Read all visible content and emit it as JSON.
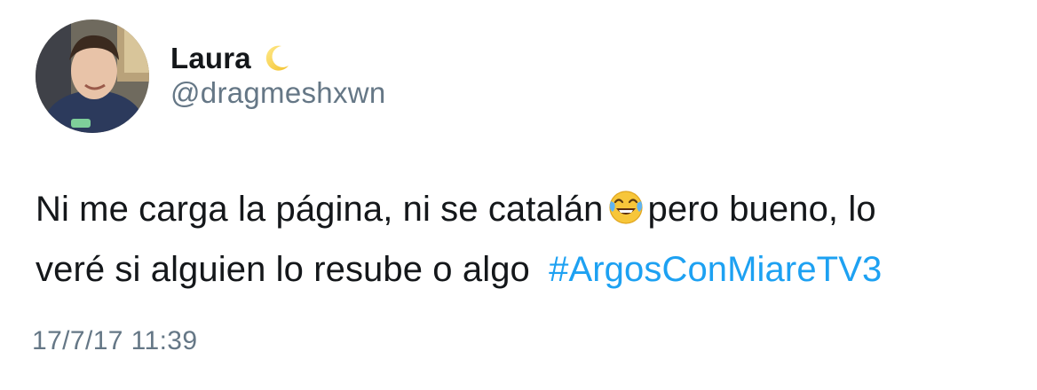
{
  "author": {
    "display_name": "Laura",
    "name_emoji_icon": "crescent-moon-icon",
    "handle": "@dragmeshxwn",
    "avatar_icon": "profile-photo"
  },
  "tweet": {
    "line1_part1": "Ni me carga la página, ni se catalán",
    "emoji_icon": "tears-of-joy-emoji-icon",
    "line1_part2": "pero bueno, lo",
    "line2_text": "veré si alguien lo resube o algo",
    "hashtag": "#ArgosConMiareTV3"
  },
  "timestamp": "17/7/17 11:39",
  "colors": {
    "text": "#14171a",
    "secondary": "#657786",
    "link": "#1da1f2"
  }
}
